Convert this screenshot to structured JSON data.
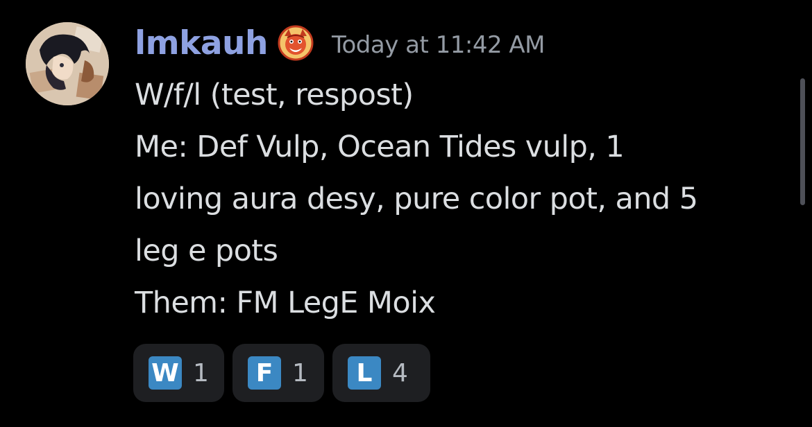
{
  "message": {
    "author": {
      "username": "lmkauh",
      "avatar_icon": "anime-character-avatar",
      "role_icon": "demon-mask-icon",
      "username_color": "#8ea1e1"
    },
    "timestamp": "Today at 11:42 AM",
    "lines": [
      "W/f/l (test, respost)",
      "Me: Def Vulp, Ocean Tides vulp, 1",
      "loving aura desy, pure color pot, and 5",
      "leg e pots",
      "Them: FM LegE Moix"
    ],
    "reactions": [
      {
        "emoji": "W",
        "emoji_icon": "regional-indicator-w-icon",
        "count": "1"
      },
      {
        "emoji": "F",
        "emoji_icon": "regional-indicator-f-icon",
        "count": "1"
      },
      {
        "emoji": "L",
        "emoji_icon": "regional-indicator-l-icon",
        "count": "4"
      }
    ]
  },
  "colors": {
    "background": "#000000",
    "text": "#dbdee1",
    "muted": "#949ba4",
    "reaction_bg": "#1e1f22",
    "emoji_blue": "#3b88c3"
  }
}
